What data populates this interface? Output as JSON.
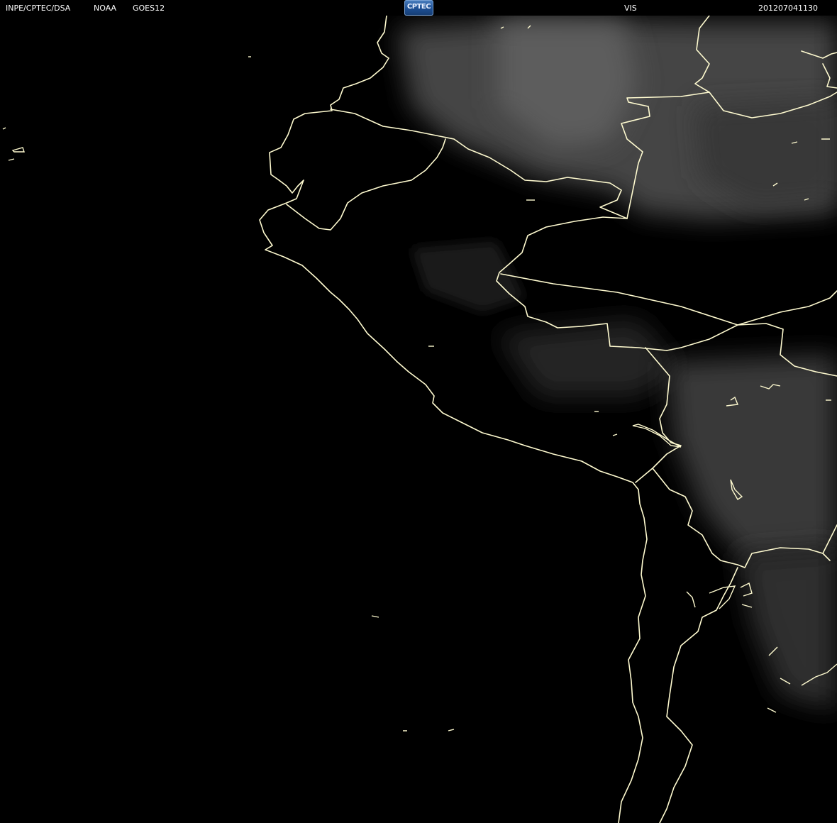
{
  "header": {
    "organization": "INPE/CPTEC/DSA",
    "agency": "NOAA",
    "satellite": "GOES12",
    "logo_text": "CPTEC",
    "channel": "VIS",
    "timestamp": "201207041130"
  },
  "colors": {
    "background": "#000000",
    "border_line": "#fffbd0",
    "cloud_light": "#6a6a6a",
    "cloud_dark": "#2a2a2a",
    "header_text": "#ffffff"
  }
}
